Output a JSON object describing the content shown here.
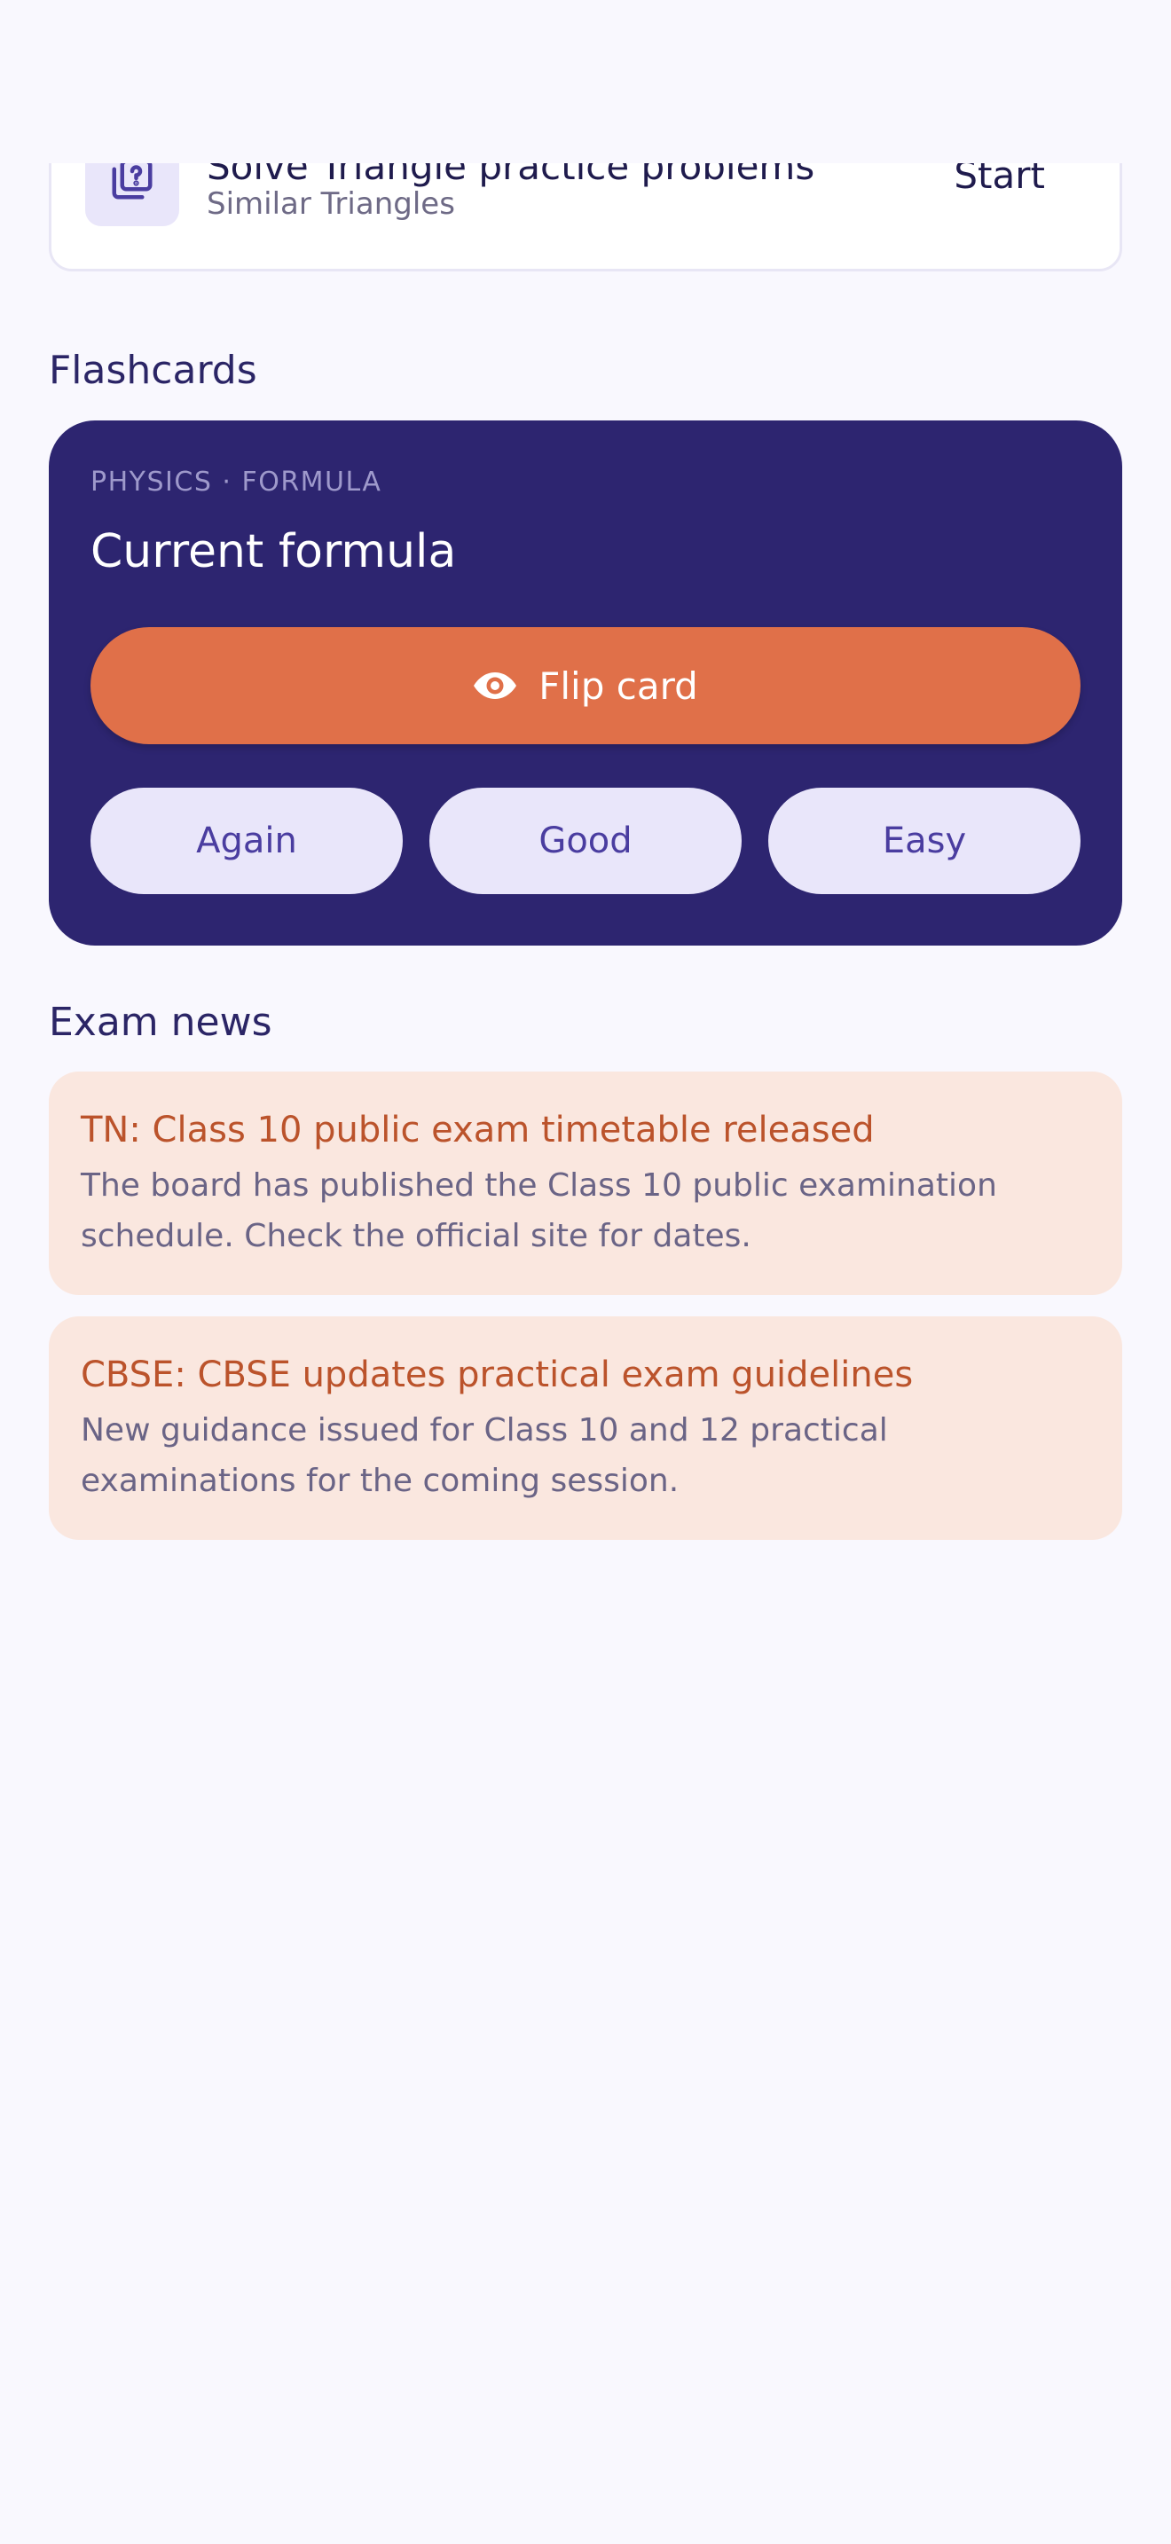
{
  "task": {
    "title": "Solve Triangle practice problems",
    "subtitle": "Similar Triangles",
    "action": "Start",
    "icon": "quiz-icon"
  },
  "flashcards": {
    "heading": "Flashcards",
    "meta": "PHYSICS · FORMULA",
    "title": "Current formula",
    "flip_label": "Flip card",
    "flip_icon": "eye-icon",
    "ratings": [
      "Again",
      "Good",
      "Easy"
    ]
  },
  "news": {
    "heading": "Exam news",
    "items": [
      {
        "title": "TN: Class 10 public exam timetable released",
        "body": "The board has published the Class 10 public examination schedule. Check the official site for dates."
      },
      {
        "title": "CBSE: CBSE updates practical exam guidelines",
        "body": "New guidance issued for Class 10 and 12 practical examinations for the coming session."
      }
    ]
  },
  "colors": {
    "background": "#F9F8FE",
    "flashcard_bg": "#2D2570",
    "accent": "#E07049",
    "rating_bg": "#E9E6FA",
    "news_bg": "#FAE7DF",
    "news_title": "#BB532B"
  }
}
